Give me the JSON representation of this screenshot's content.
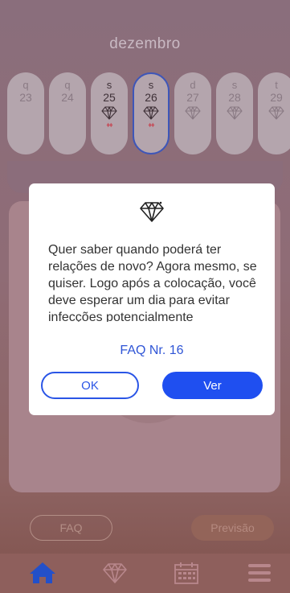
{
  "calendar": {
    "month": "dezembro",
    "days": [
      {
        "weekday": "q",
        "day": "23",
        "gem": false,
        "drops": "",
        "active": false,
        "selected": false
      },
      {
        "weekday": "q",
        "day": "24",
        "gem": false,
        "drops": "",
        "active": false,
        "selected": false
      },
      {
        "weekday": "s",
        "day": "25",
        "gem": true,
        "drops": "💧💧",
        "active": true,
        "selected": false
      },
      {
        "weekday": "s",
        "day": "26",
        "gem": true,
        "drops": "💧💧",
        "active": true,
        "selected": true
      },
      {
        "weekday": "d",
        "day": "27",
        "gem": true,
        "drops": "",
        "active": false,
        "selected": false
      },
      {
        "weekday": "s",
        "day": "28",
        "gem": true,
        "drops": "",
        "active": false,
        "selected": false
      },
      {
        "weekday": "t",
        "day": "29",
        "gem": true,
        "drops": "",
        "active": false,
        "selected": false
      }
    ]
  },
  "buttons": {
    "faq": "FAQ",
    "forecast": "Previsão"
  },
  "dialog": {
    "icon": "diamond-icon",
    "message": "Quer saber quando poderá ter relações de novo? Agora mesmo, se quiser. Logo após a colocação, você deve esperar um dia para evitar infecções potencialmente",
    "link": "FAQ Nr. 16",
    "ok_label": "OK",
    "view_label": "Ver"
  },
  "tabbar": {
    "items": [
      "home-icon",
      "diamond-icon",
      "calendar-icon",
      "menu-icon"
    ]
  },
  "colors": {
    "accent": "#1f4ff0",
    "drop": "#c35662"
  }
}
